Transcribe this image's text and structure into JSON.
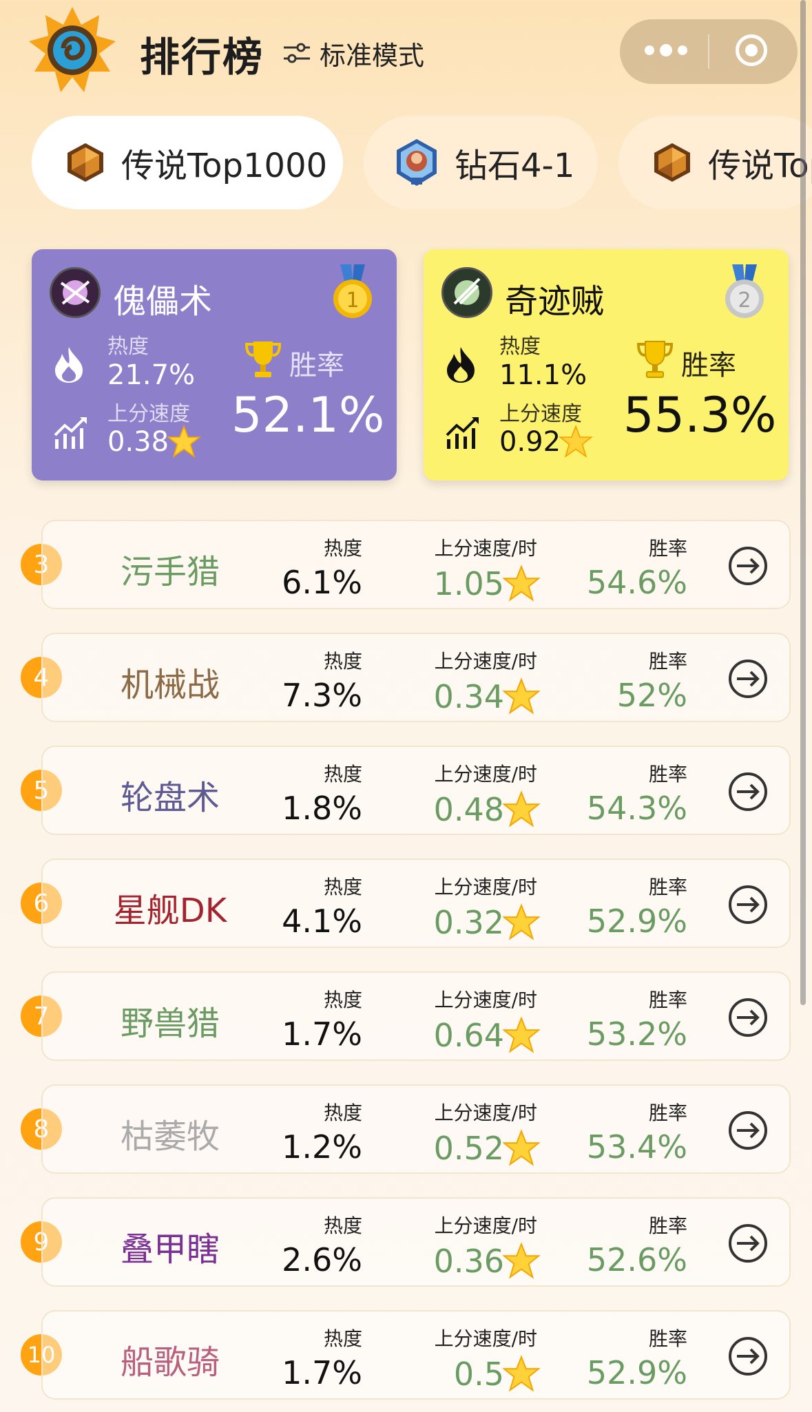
{
  "header": {
    "title": "排行榜",
    "mode_label": "标准模式"
  },
  "tabs": [
    {
      "label": "传说Top1000",
      "active": true,
      "icon": "legend-rank-icon"
    },
    {
      "label": "钻石4-1",
      "active": false,
      "icon": "diamond-rank-icon"
    },
    {
      "label": "传说Top",
      "active": false,
      "icon": "legend-rank-icon"
    }
  ],
  "top_cards": [
    {
      "rank": 1,
      "name": "傀儡术",
      "heat_label": "热度",
      "heat": "21.7%",
      "speed_label": "上分速度",
      "speed": "0.38",
      "winrate_label": "胜率",
      "winrate": "52.1%",
      "medal": "gold-medal-icon",
      "medal_text": "1"
    },
    {
      "rank": 2,
      "name": "奇迹贼",
      "heat_label": "热度",
      "heat": "11.1%",
      "speed_label": "上分速度",
      "speed": "0.92",
      "winrate_label": "胜率",
      "winrate": "55.3%",
      "medal": "silver-medal-icon",
      "medal_text": "2"
    }
  ],
  "columns": {
    "heat": "热度",
    "speed": "上分速度/时",
    "winrate": "胜率"
  },
  "rows": [
    {
      "rank": "3",
      "name": "污手猎",
      "name_color": "#6a9b62",
      "heat": "6.1%",
      "speed": "1.05",
      "winrate": "54.6%"
    },
    {
      "rank": "4",
      "name": "机械战",
      "name_color": "#8b6a45",
      "heat": "7.3%",
      "speed": "0.34",
      "winrate": "52%"
    },
    {
      "rank": "5",
      "name": "轮盘术",
      "name_color": "#5e5a94",
      "heat": "1.8%",
      "speed": "0.48",
      "winrate": "54.3%"
    },
    {
      "rank": "6",
      "name": "星舰DK",
      "name_color": "#a3242e",
      "heat": "4.1%",
      "speed": "0.32",
      "winrate": "52.9%"
    },
    {
      "rank": "7",
      "name": "野兽猎",
      "name_color": "#6a9b62",
      "heat": "1.7%",
      "speed": "0.64",
      "winrate": "53.2%"
    },
    {
      "rank": "8",
      "name": "枯萎牧",
      "name_color": "#aaaaaa",
      "heat": "1.2%",
      "speed": "0.52",
      "winrate": "53.4%"
    },
    {
      "rank": "9",
      "name": "叠甲瞎",
      "name_color": "#7a2f95",
      "heat": "2.6%",
      "speed": "0.36",
      "winrate": "52.6%"
    },
    {
      "rank": "10",
      "name": "船歌骑",
      "name_color": "#b8607e",
      "heat": "1.7%",
      "speed": "0.5",
      "winrate": "52.9%"
    }
  ]
}
